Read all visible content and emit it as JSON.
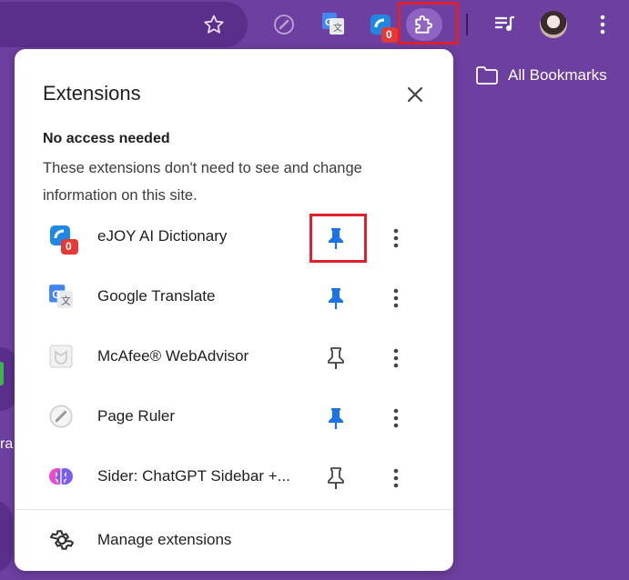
{
  "toolbar": {
    "icons": [
      "star-icon",
      "page-ruler-icon",
      "google-translate-icon",
      "ejoy-icon",
      "extensions-puzzle-icon",
      "media-queue-icon",
      "avatar",
      "more-vert-icon"
    ],
    "ejoy_badge": "0"
  },
  "bookmarks": {
    "label": "All Bookmarks",
    "icon": "folder-icon"
  },
  "background": {
    "partial_text": "ra"
  },
  "popup": {
    "title": "Extensions",
    "section_title": "No access needed",
    "section_desc": "These extensions don't need to see and change information on this site.",
    "extensions": [
      {
        "name": "eJOY AI Dictionary",
        "badge": "0",
        "pinned": true,
        "icon": "ejoy-icon"
      },
      {
        "name": "Google Translate",
        "pinned": true,
        "icon": "google-translate-icon"
      },
      {
        "name": "McAfee® WebAdvisor",
        "pinned": false,
        "icon": "mcafee-icon"
      },
      {
        "name": "Page Ruler",
        "pinned": true,
        "icon": "page-ruler-icon"
      },
      {
        "name": "Sider: ChatGPT Sidebar +...",
        "pinned": false,
        "icon": "sider-brain-icon"
      }
    ],
    "manage_label": "Manage extensions"
  },
  "colors": {
    "background": "#6d3fa0",
    "pin_blue": "#1a73e8",
    "highlight_red": "#e0202c",
    "badge_red": "#e53935"
  }
}
